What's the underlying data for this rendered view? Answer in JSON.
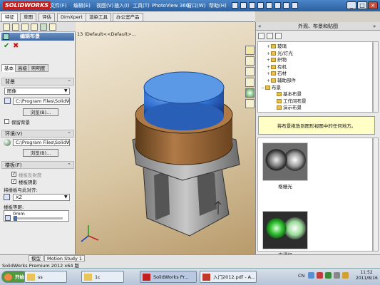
{
  "app": {
    "logo": "SOLIDWORKS",
    "menus": [
      "文件(F)",
      "编辑(E)",
      "视图(V)",
      "插入(I)",
      "工具(T)",
      "PhotoView 360",
      "窗口(W)",
      "帮助(H)"
    ],
    "window_controls": [
      "_",
      "□",
      "×"
    ]
  },
  "cm_tabs": [
    "特征",
    "草图",
    "评估",
    "DimXpert",
    "渲染工具",
    "办公室产品"
  ],
  "viewport": {
    "tree_text": "13 (Default<<Default>..."
  },
  "panel": {
    "title": "编辑布景",
    "ok": "✔",
    "cancel": "✖",
    "subtabs": [
      "基本",
      "高级",
      "照明度"
    ],
    "background": {
      "header": "背景",
      "type_value": "图像",
      "path_value": "C:\\Program Files\\SolidWorks C",
      "browse": "浏览(B)...",
      "keep_label": "保留背景"
    },
    "environment": {
      "header": "环境(V)",
      "path_value": "C:\\Program Files\\SolidWorks C",
      "browse": "浏览(B)..."
    },
    "floor": {
      "header": "楼板(F)",
      "floor_reflect_label": "楼板反射度",
      "floor_shadow_label": "楼板阴影",
      "align_label": "将楼板与此对齐:",
      "align_value": "XZ",
      "offset_label": "楼板等距:",
      "offset_value": "0mm"
    }
  },
  "right": {
    "title": "外观、布景和贴图",
    "tree": [
      {
        "label": "玻璃",
        "level": 1,
        "expander": "+"
      },
      {
        "label": "光/灯光",
        "level": 1,
        "expander": "+"
      },
      {
        "label": "织物",
        "level": 1,
        "expander": "+"
      },
      {
        "label": "有机",
        "level": 1,
        "expander": "+"
      },
      {
        "label": "石材",
        "level": 1,
        "expander": "+"
      },
      {
        "label": "辅助部件",
        "level": 1,
        "expander": "+"
      },
      {
        "label": "布景",
        "level": 0,
        "expander": "−"
      },
      {
        "label": "基本布景",
        "level": 2,
        "expander": ""
      },
      {
        "label": "工作间布景",
        "level": 2,
        "expander": ""
      },
      {
        "label": "演示布景",
        "level": 2,
        "expander": ""
      }
    ],
    "hint": "将布景拖放到图形视图中的任何地方。",
    "thumbs": [
      "格栅光",
      "灾通灯"
    ]
  },
  "bottom_tabs": [
    "模型",
    "Motion Study 1"
  ],
  "status": "SolidWorks Premium 2012 x64 版",
  "taskbar": {
    "start": "开始",
    "items": [
      "ss",
      "1c",
      "SolidWorks Pr...",
      "入门2012.pdf - A..."
    ],
    "tray_lang": "CN",
    "clock_time": "11:52",
    "clock_date": "2011/8/16"
  },
  "colors": {
    "title_blue": "#3a72b8",
    "part_blue": "#2f6fd0",
    "part_bronze": "#8a5a2e",
    "hint_yellow": "#ffffc6"
  }
}
